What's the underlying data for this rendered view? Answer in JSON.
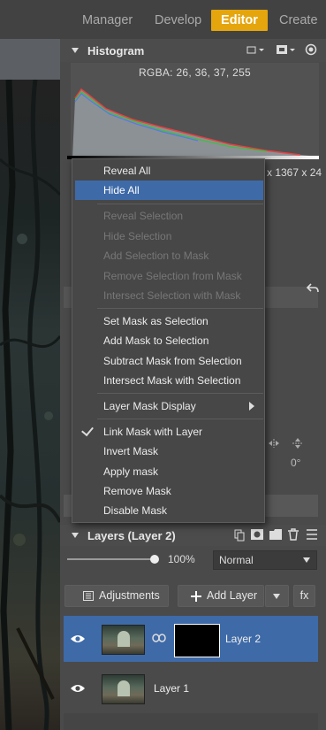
{
  "topbar": {
    "tabs": [
      {
        "label": "Manager"
      },
      {
        "label": "Develop"
      },
      {
        "label": "Editor",
        "active": true
      },
      {
        "label": "Create"
      }
    ]
  },
  "histogram": {
    "title": "Histogram",
    "rgba": "RGBA:  26,  36,  37, 255",
    "dimensions": "x 1367 x 24"
  },
  "context_menu": {
    "items": [
      {
        "label": "Reveal All",
        "enabled": true
      },
      {
        "label": "Hide All",
        "enabled": true,
        "highlighted": true
      },
      {
        "label": "Reveal Selection",
        "enabled": false
      },
      {
        "label": "Hide Selection",
        "enabled": false
      },
      {
        "label": "Add Selection to Mask",
        "enabled": false
      },
      {
        "label": "Remove Selection from Mask",
        "enabled": false
      },
      {
        "label": "Intersect Selection with Mask",
        "enabled": false
      },
      {
        "label": "Set Mask as Selection",
        "enabled": true
      },
      {
        "label": "Add Mask to Selection",
        "enabled": true
      },
      {
        "label": "Subtract Mask from Selection",
        "enabled": true
      },
      {
        "label": "Intersect Mask with Selection",
        "enabled": true
      },
      {
        "label": "Layer Mask Display",
        "enabled": true,
        "submenu": true
      },
      {
        "label": "Link Mask with Layer",
        "enabled": true,
        "checked": true
      },
      {
        "label": "Invert Mask",
        "enabled": true
      },
      {
        "label": "Apply mask",
        "enabled": true
      },
      {
        "label": "Remove Mask",
        "enabled": true
      },
      {
        "label": "Disable Mask",
        "enabled": true
      }
    ]
  },
  "hidden_panel": {
    "angle": "0°"
  },
  "layers": {
    "title": "Layers (Layer 2)",
    "opacity": "100%",
    "blend_mode": "Normal",
    "adjustments_label": "Adjustments",
    "add_layer_label": "Add Layer",
    "fx_label": "fx",
    "items": [
      {
        "name": "Layer 2",
        "selected": true,
        "has_mask": true
      },
      {
        "name": "Layer 1",
        "selected": false
      }
    ]
  },
  "colors": {
    "accent": "#e5a50d",
    "selection": "#3e6aa8"
  }
}
